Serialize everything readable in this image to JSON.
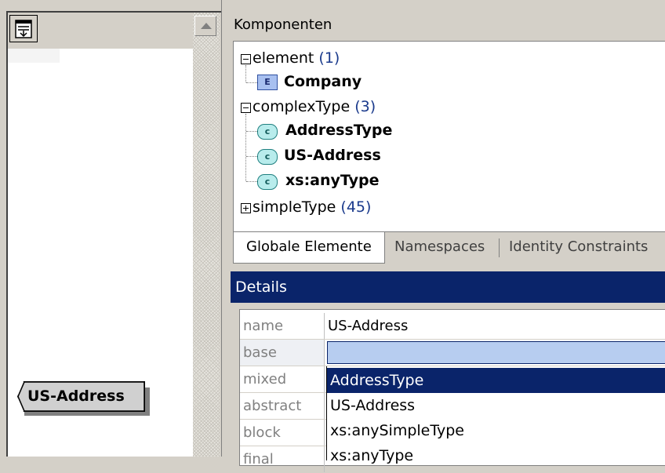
{
  "components_panel": {
    "title": "Komponenten",
    "tree": {
      "element_group": {
        "label": "element",
        "count": "(1)",
        "items": [
          {
            "icon": "E",
            "name": "Company"
          }
        ]
      },
      "complextype_group": {
        "label": "complexType",
        "count": "(3)",
        "items": [
          {
            "icon": "c",
            "name": "AddressType"
          },
          {
            "icon": "c",
            "name": "US-Address"
          },
          {
            "icon": "c",
            "name": "xs:anyType"
          }
        ]
      },
      "simpletype_group": {
        "label": "simpleType",
        "count": "(45)"
      }
    },
    "tabs": [
      {
        "label": "Globale Elemente",
        "active": true
      },
      {
        "label": "Namespaces",
        "active": false
      },
      {
        "label": "Identity Constraints",
        "active": false
      }
    ]
  },
  "details_panel": {
    "title": "Details",
    "properties": [
      {
        "name": "name",
        "value": "US-Address"
      },
      {
        "name": "base",
        "value": ""
      },
      {
        "name": "mixed",
        "value": ""
      },
      {
        "name": "abstract",
        "value": ""
      },
      {
        "name": "block",
        "value": ""
      },
      {
        "name": "final",
        "value": ""
      }
    ],
    "base_dropdown": {
      "options": [
        "AddressType",
        "US-Address",
        "xs:anySimpleType",
        "xs:anyType"
      ],
      "selected": "AddressType"
    }
  },
  "diagram": {
    "node_label": "US-Address"
  },
  "colors": {
    "accent": "#0a246a",
    "selection_fill": "#b7cdf0",
    "panel_bg": "#d4d0c8"
  },
  "icons": {
    "show_globals": "show-globals-icon",
    "scroll_up": "arrow-up-icon"
  }
}
